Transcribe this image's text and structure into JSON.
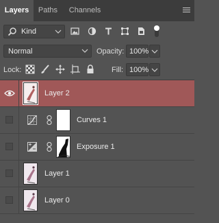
{
  "tabs": [
    {
      "label": "Layers",
      "active": true
    },
    {
      "label": "Paths",
      "active": false
    },
    {
      "label": "Channels",
      "active": false
    }
  ],
  "filter": {
    "kind_label": "Kind",
    "filter_icons": [
      "image-filter-icon",
      "adjustment-filter-icon",
      "type-filter-icon",
      "shape-filter-icon",
      "smart-object-filter-icon",
      "filter-toggle-icon"
    ]
  },
  "blend": {
    "mode": "Normal",
    "opacity_label": "Opacity:",
    "opacity_value": "100%"
  },
  "lock": {
    "label": "Lock:",
    "lock_icons": [
      "lock-transparent-pixels-icon",
      "lock-image-pixels-icon",
      "lock-position-icon",
      "lock-artboard-icon",
      "lock-all-icon"
    ],
    "fill_label": "Fill:",
    "fill_value": "100%"
  },
  "layers": [
    {
      "name": "Layer 2",
      "type": "pixel",
      "visible": true,
      "selected": true
    },
    {
      "name": "Curves 1",
      "type": "curves-adjustment",
      "visible": false,
      "selected": false
    },
    {
      "name": "Exposure 1",
      "type": "exposure-adjustment",
      "visible": false,
      "selected": false
    },
    {
      "name": "Layer 1",
      "type": "pixel",
      "visible": false,
      "selected": false
    },
    {
      "name": "Layer 0",
      "type": "pixel",
      "visible": false,
      "selected": false
    }
  ],
  "colors": {
    "panel_bg": "#535353",
    "tabbar_bg": "#3c3c3c",
    "selected_layer": "#a05858"
  }
}
